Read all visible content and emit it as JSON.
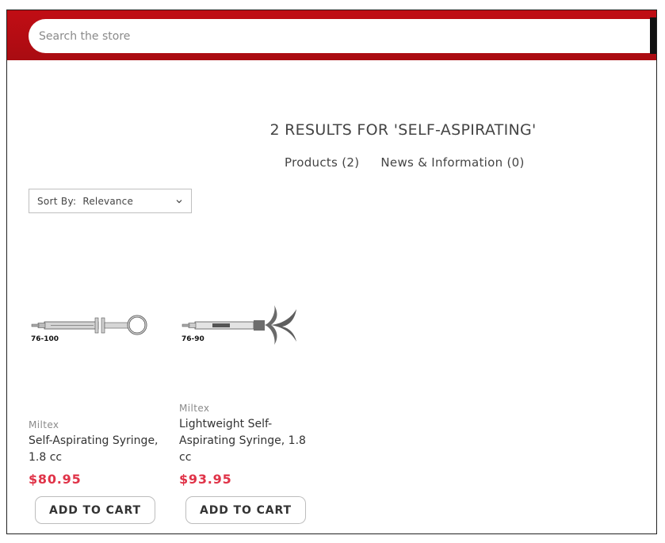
{
  "search": {
    "placeholder": "Search the store",
    "value": ""
  },
  "results": {
    "title": "2 RESULTS FOR 'SELF-ASPIRATING'",
    "tabs": [
      {
        "label": "Products (2)"
      },
      {
        "label": "News & Information (0)"
      }
    ]
  },
  "sort": {
    "label": "Sort By:",
    "value": "Relevance"
  },
  "products": [
    {
      "sku": "76-100",
      "brand": "Miltex",
      "name": "Self-Aspirating Syringe, 1.8 cc",
      "price": "$80.95",
      "cta": "ADD TO CART"
    },
    {
      "sku": "76-90",
      "brand": "Miltex",
      "name": "Lightweight Self-Aspirating Syringe, 1.8 cc",
      "price": "$93.95",
      "cta": "ADD TO CART"
    }
  ],
  "colors": {
    "header": "#b30f14",
    "price": "#e03348"
  },
  "icons": {
    "sort_toggle": "chevron-down-icon"
  }
}
